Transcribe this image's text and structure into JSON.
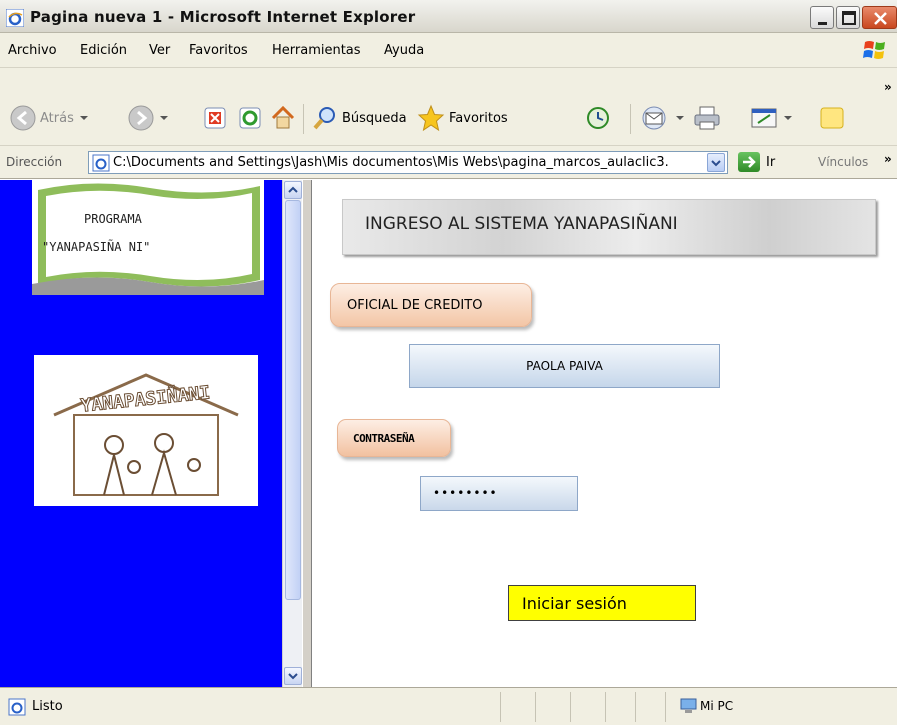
{
  "window": {
    "title": "Pagina nueva 1 - Microsoft Internet Explorer"
  },
  "menu": [
    "Archivo",
    "Edición",
    "Ver",
    "Favoritos",
    "Herramientas",
    "Ayuda"
  ],
  "toolbar": {
    "back_label": "Atrás",
    "search_label": "Búsqueda",
    "favorites_label": "Favoritos"
  },
  "address": {
    "label": "Dirección",
    "url": "C:\\Documents and Settings\\Jash\\Mis documentos\\Mis Webs\\pagina_marcos_aulaclic3.",
    "go_label": "Ir",
    "links_label": "Vínculos"
  },
  "left_frame": {
    "logo_line1": "PROGRAMA",
    "logo_line2": "\"YANAPASIÑA NI\"",
    "emblem_text": "YANAPASIÑANI"
  },
  "page": {
    "heading": "INGRESO AL SISTEMA  YANAPASIÑANI",
    "officer_label": "OFICIAL DE CREDITO",
    "user_value": "PAOLA PAIVA",
    "password_label": "CONTRASEÑA",
    "password_value": "••••••••",
    "login_label": "Iniciar sesión"
  },
  "status": {
    "text": "Listo",
    "zone": "Mi PC"
  },
  "colors": {
    "left_frame_bg": "#0000ff",
    "login_bg": "#ffff00",
    "orange_button": "#f3c6a6",
    "blue_field": "#c5d6ea"
  }
}
